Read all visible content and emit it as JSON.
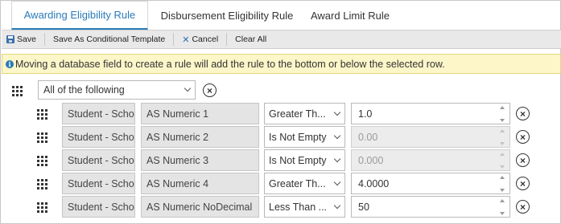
{
  "tabs": [
    {
      "label": "Awarding Eligibility Rule",
      "active": true
    },
    {
      "label": "Disbursement Eligibility Rule",
      "active": false
    },
    {
      "label": "Award Limit Rule",
      "active": false
    }
  ],
  "toolbar": {
    "save": "Save",
    "save_conditional": "Save As Conditional Template",
    "cancel": "Cancel",
    "clear_all": "Clear All"
  },
  "info_message": "Moving a database field to create a rule will add the rule to the bottom or below the selected row.",
  "group": {
    "condition": "All of the following"
  },
  "rules": [
    {
      "entity": "Student - Scho",
      "field": "AS Numeric 1",
      "operator": "Greater Th...",
      "value": "1.0",
      "disabled": false
    },
    {
      "entity": "Student - Scho",
      "field": "AS Numeric 2",
      "operator": "Is Not Empty",
      "value": "0.00",
      "disabled": true
    },
    {
      "entity": "Student - Scho",
      "field": "AS Numeric 3",
      "operator": "Is Not Empty",
      "value": "0.000",
      "disabled": true
    },
    {
      "entity": "Student - Scho",
      "field": "AS Numeric 4",
      "operator": "Greater Th...",
      "value": "4.0000",
      "disabled": false
    },
    {
      "entity": "Student - Scho",
      "field": "AS Numeric NoDecimal",
      "operator": "Less Than ...",
      "value": "50",
      "disabled": false
    }
  ],
  "colors": {
    "accent": "#2a7ab8",
    "info_bg": "#fcf6c8",
    "toolbar_bg": "#e9e9e9"
  }
}
